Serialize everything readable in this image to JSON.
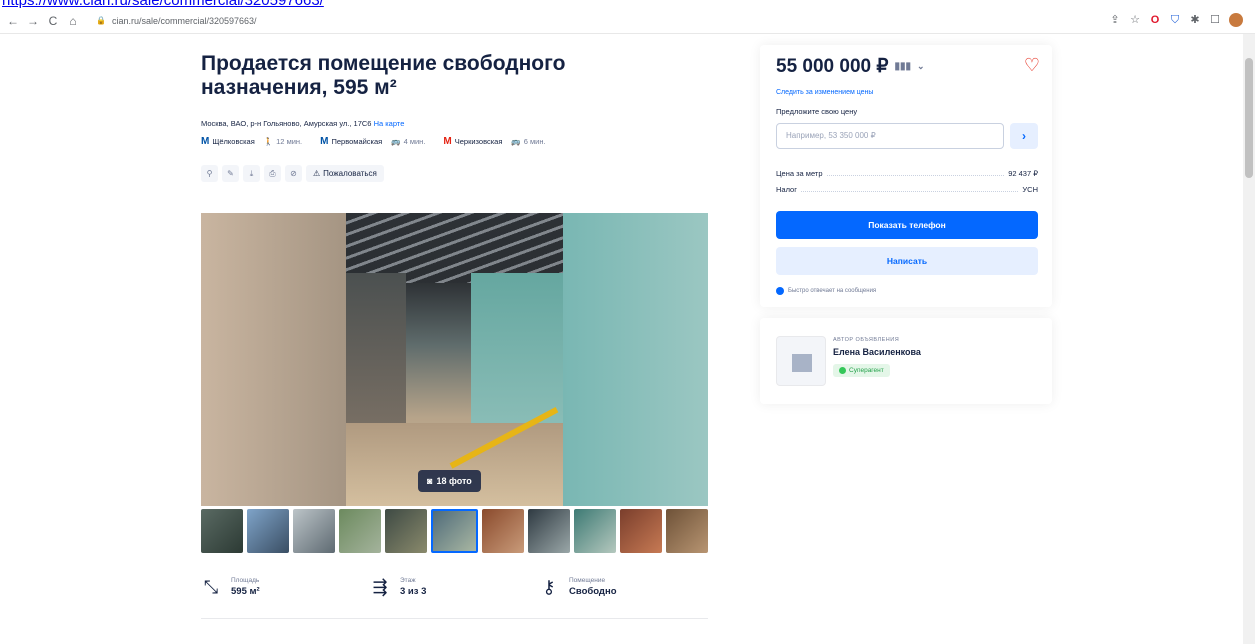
{
  "toplink": "https://www.cian.ru/sale/commercial/320597663/",
  "browser": {
    "url": "cian.ru/sale/commercial/320597663/",
    "nav_back": "←",
    "nav_forward": "→",
    "nav_reload": "C",
    "nav_home": "⌂",
    "lock_icon": "🔒",
    "ext_share": "⇪",
    "ext_star": "☆",
    "ext_opera": "O",
    "ext_shield": "⛉",
    "ext_puzzle": "✱",
    "ext_window": "☐"
  },
  "listing": {
    "title": "Продается помещение свободного назначения, 595 м²",
    "address": "Москва, ВАО, р-н Гольяново, Амурская ул., 17С6",
    "map_link": "На карте",
    "metro": [
      {
        "station": "Щёлковская",
        "time": "12 мин.",
        "mode_icon": "🚶",
        "color": "#0053a6"
      },
      {
        "station": "Первомайская",
        "time": "4 мин.",
        "mode_icon": "🚌",
        "color": "#0053a6"
      },
      {
        "station": "Черкизовская",
        "time": "6 мин.",
        "mode_icon": "🚌",
        "color": "#e42313"
      }
    ],
    "tools": [
      "⚲",
      "✎",
      "⤓",
      "⎙",
      "⊘"
    ],
    "report_label": "Пожаловаться",
    "photo_count": "18 фото"
  },
  "params": [
    {
      "icon": "⤡",
      "label": "Площадь",
      "value": "595 м²"
    },
    {
      "icon": "⇶",
      "label": "Этаж",
      "value": "3 из 3"
    },
    {
      "icon": "⚷",
      "label": "Помещение",
      "value": "Свободно"
    }
  ],
  "sidebar": {
    "price": "55 000 000 ₽",
    "follow_price": "Следить за изменением цены",
    "offer_label": "Предложите свою цену",
    "offer_placeholder": "Например, 53 350 000 ₽",
    "offer_button": "›",
    "price_per_meter_label": "Цена за метр",
    "price_per_meter_value": "92 437 ₽",
    "tax_label": "Налог",
    "tax_value": "УСН",
    "show_phone": "Показать телефон",
    "write": "Написать",
    "quick_reply": "Быстро отвечает на сообщения"
  },
  "author": {
    "role": "АВТОР ОБЪЯВЛЕНИЯ",
    "name": "Елена Василенкова",
    "badge": "Суперагент"
  },
  "colors": {
    "accent": "#0468ff",
    "text": "#152242",
    "heart": "#e42313",
    "badge_green": "#23a14a"
  }
}
